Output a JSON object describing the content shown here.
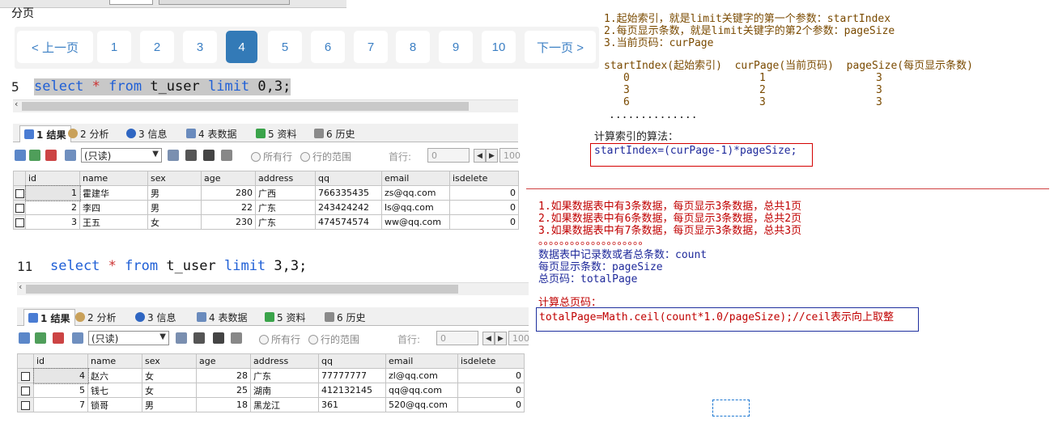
{
  "header": {
    "title": "分页"
  },
  "pagination": {
    "prev": "< 上一页",
    "pages": [
      "1",
      "2",
      "3",
      "4",
      "5",
      "6",
      "7",
      "8",
      "9",
      "10"
    ],
    "active_page": "4",
    "next": "下一页 >"
  },
  "panel1": {
    "line_no": "5",
    "sql": {
      "k1": "select",
      "rest1": " * ",
      "k2": "from",
      "rest2": " t_user ",
      "k3": "limit",
      "rest3": " 0,3;"
    },
    "tabs": [
      "1 结果",
      "2 分析",
      "3 信息",
      "4 表数据",
      "5 资料",
      "6 历史"
    ],
    "readonly": "(只读)",
    "radio_all": "所有行",
    "radio_range": "行的范围",
    "first_row_label": "首行:",
    "first_row_value": "0",
    "row_count_value": "100",
    "columns": [
      "id",
      "name",
      "sex",
      "age",
      "address",
      "qq",
      "email",
      "isdelete"
    ],
    "rows": [
      [
        "1",
        "霍建华",
        "男",
        "280",
        "广西",
        "766335435",
        "zs@qq.com",
        "0"
      ],
      [
        "2",
        "李四",
        "男",
        "22",
        "广东",
        "243424242",
        "ls@qq.com",
        "0"
      ],
      [
        "3",
        "王五",
        "女",
        "230",
        "广东",
        "474574574",
        "ww@qq.com",
        "0"
      ]
    ]
  },
  "panel2": {
    "line_no": "11",
    "sql": {
      "k1": "select",
      "rest1": " * ",
      "k2": "from",
      "rest2": " t_user ",
      "k3": "limit",
      "rest3": " 3,3;"
    },
    "tabs": [
      "1 结果",
      "2 分析",
      "3 信息",
      "4 表数据",
      "5 资料",
      "6 历史"
    ],
    "readonly": "(只读)",
    "radio_all": "所有行",
    "radio_range": "行的范围",
    "first_row_label": "首行:",
    "first_row_value": "0",
    "row_count_value": "100",
    "columns": [
      "id",
      "name",
      "sex",
      "age",
      "address",
      "qq",
      "email",
      "isdelete"
    ],
    "rows": [
      [
        "4",
        "赵六",
        "女",
        "28",
        "广东",
        "77777777",
        "zl@qq.com",
        "0"
      ],
      [
        "5",
        "钱七",
        "女",
        "25",
        "湖南",
        "412132145",
        "qq@qq.com",
        "0"
      ],
      [
        "7",
        "锁哥",
        "男",
        "18",
        "黑龙江",
        "361",
        "520@qq.com",
        "0"
      ]
    ]
  },
  "notes_top": {
    "lines": [
      "1.起始索引，就是limit关键字的第一个参数：startIndex",
      "2.每页显示条数，就是limit关键字的第2个参数：pageSize",
      "3.当前页码：curPage"
    ],
    "table_header": "startIndex(起始索引)  curPage(当前页码)  pageSize(每页显示条数)",
    "table_rows": [
      [
        "0",
        "1",
        "3"
      ],
      [
        "3",
        "2",
        "3"
      ],
      [
        "6",
        "3",
        "3"
      ]
    ],
    "dots": "..............",
    "algo_title": "计算索引的算法：",
    "formula": "startIndex=(curPage-1)*pageSize;"
  },
  "notes_bottom": {
    "lines": [
      "1.如果数据表中有3条数据，每页显示3条数据，总共1页",
      "2.如果数据表中有6条数据，每页显示3条数据，总共2页",
      "3.如果数据表中有7条数据，每页显示3条数据，总共3页"
    ],
    "dots": "。。。。。。。。。。。。。。。。。。。。",
    "count_line": "数据表中记录数或者总条数：count",
    "pagesize_line": "每页显示条数：pageSize",
    "total_line": "总页码：totalPage",
    "algo_title": "计算总页码：",
    "formula": "totalPage=Math.ceil(count*1.0/pageSize);//ceil表示向上取整"
  },
  "colors": {
    "accent": "#337ab7",
    "link": "#3b7fc4",
    "note_brown": "#7a4a00",
    "note_red": "#c00000",
    "note_blue": "#1f2a9b",
    "keyword": "#1f5fd6"
  }
}
